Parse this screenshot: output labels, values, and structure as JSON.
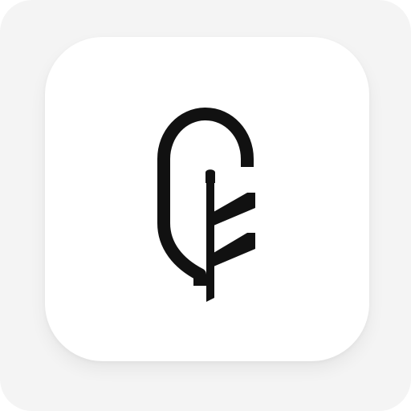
{
  "icon": {
    "name": "feather-icon",
    "colors": {
      "outer_background": "#f4f4f4",
      "tile_background": "#ffffff",
      "glyph": "#111111"
    }
  }
}
